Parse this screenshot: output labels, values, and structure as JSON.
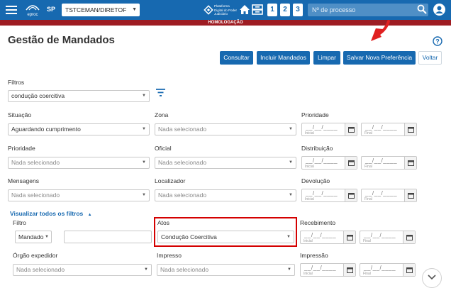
{
  "topbar": {
    "logo_text": "eproc",
    "region": "SP",
    "user_select": "TSTCEMAN/DIRETOF",
    "platform_text": "Plataforma Digital do Poder Judiciário",
    "quick_numbers": [
      "1",
      "2",
      "3"
    ],
    "search_placeholder": "Nº de processo"
  },
  "environment_banner": "HOMOLOGAÇÃO",
  "page": {
    "title": "Gestão de Mandados"
  },
  "actions": {
    "consultar": "Consultar",
    "incluir": "Incluir Mandados",
    "limpar": "Limpar",
    "salvar": "Salvar Nova Preferência",
    "voltar": "Voltar"
  },
  "filters": {
    "label": "Filtros",
    "selected": "condução coercitiva"
  },
  "fields": {
    "situacao": {
      "label": "Situação",
      "value": "Aguardando cumprimento"
    },
    "zona": {
      "label": "Zona",
      "value": "Nada selecionado"
    },
    "prioridade_date": {
      "label": "Prioridade"
    },
    "prioridade": {
      "label": "Prioridade",
      "value": "Nada selecionado"
    },
    "oficial": {
      "label": "Oficial",
      "value": "Nada selecionado"
    },
    "distribuicao": {
      "label": "Distribuição"
    },
    "mensagens": {
      "label": "Mensagens",
      "value": "Nada selecionado"
    },
    "localizador": {
      "label": "Localizador",
      "value": "Nada selecionado"
    },
    "devolucao": {
      "label": "Devolução"
    },
    "filtro": {
      "label": "Filtro",
      "value": "Mandado"
    },
    "atos": {
      "label": "Atos",
      "value": "Condução Coercitiva"
    },
    "recebimento": {
      "label": "Recebimento"
    },
    "orgao": {
      "label": "Órgão expedidor",
      "value": "Nada selecionado"
    },
    "impresso": {
      "label": "Impresso",
      "value": "Nada selecionado"
    },
    "impressao": {
      "label": "Impressão"
    }
  },
  "toggle_filters": "Visualizar todos os filtros",
  "date_placeholder": "__/__/____",
  "date_start_label": "Inicial",
  "date_end_label": "Final",
  "colors": {
    "primary": "#1769b0",
    "banner": "#9e1c22",
    "highlight": "#d40000"
  }
}
